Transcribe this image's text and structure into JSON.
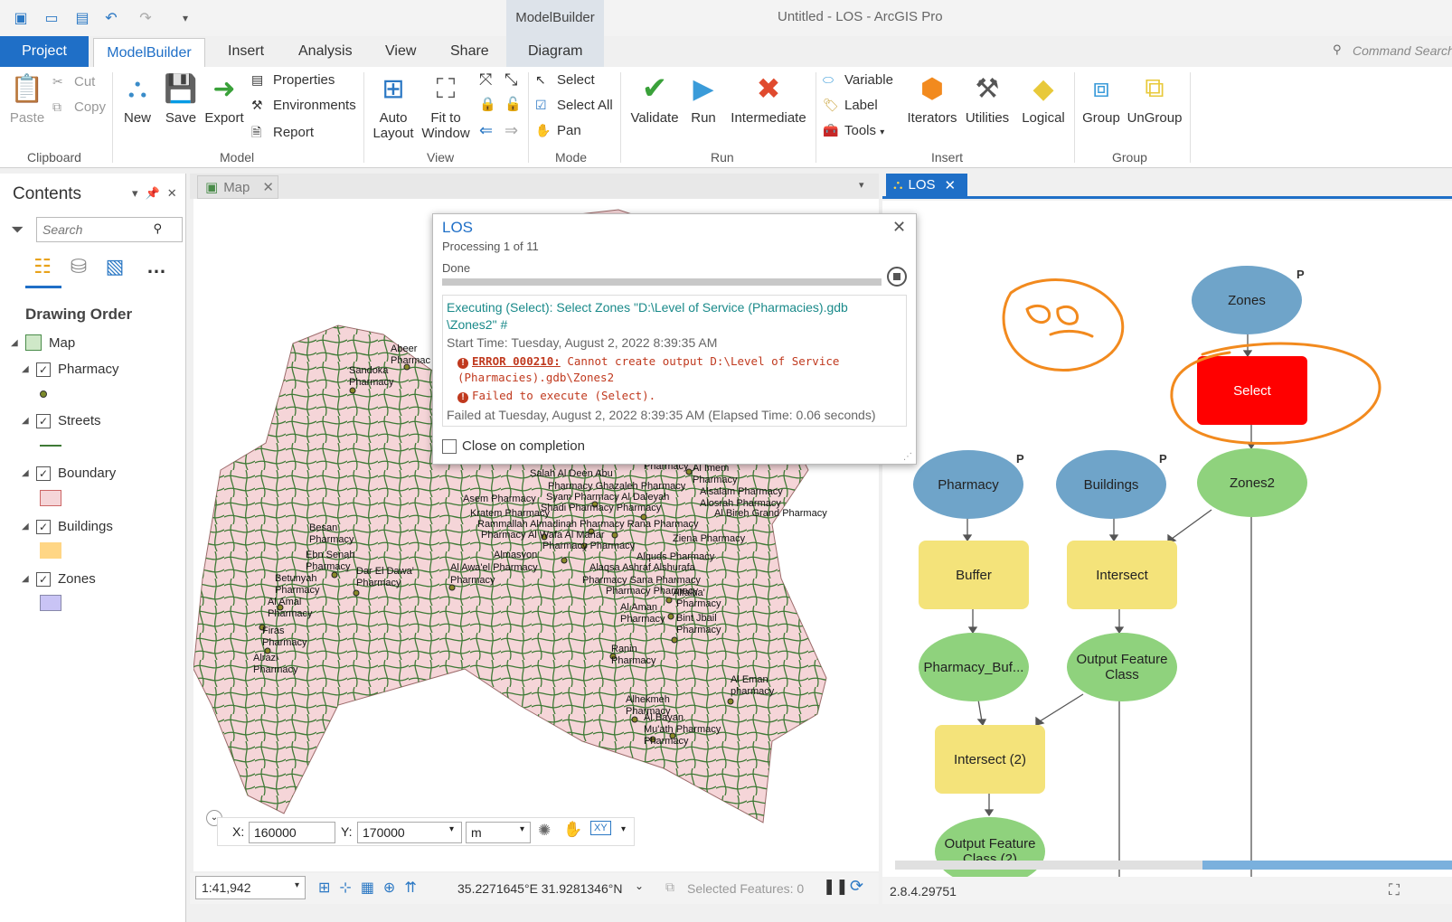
{
  "titlebar": {
    "contextual_group": "ModelBuilder",
    "window_title": "Untitled - LOS - ArcGIS Pro"
  },
  "ribbon_tabs": {
    "project": "Project",
    "modelbuilder": "ModelBuilder",
    "insert": "Insert",
    "analysis": "Analysis",
    "view": "View",
    "share": "Share",
    "diagram": "Diagram",
    "command_search": "Command Search"
  },
  "ribbon": {
    "clipboard": {
      "paste": "Paste",
      "cut": "Cut",
      "copy": "Copy",
      "label": "Clipboard"
    },
    "model": {
      "new": "New",
      "save": "Save",
      "export": "Export",
      "properties": "Properties",
      "environments": "Environments",
      "report": "Report",
      "label": "Model"
    },
    "view": {
      "auto_layout_1": "Auto",
      "auto_layout_2": "Layout",
      "fit_1": "Fit to",
      "fit_2": "Window",
      "label": "View"
    },
    "mode": {
      "select": "Select",
      "select_all": "Select All",
      "pan": "Pan",
      "label": "Mode"
    },
    "run": {
      "validate": "Validate",
      "run": "Run",
      "intermediate": "Intermediate",
      "label": "Run"
    },
    "insert": {
      "variable": "Variable",
      "label_btn": "Label",
      "tools": "Tools",
      "iterators": "Iterators",
      "utilities": "Utilities",
      "logical": "Logical",
      "label": "Insert"
    },
    "group": {
      "group": "Group",
      "ungroup": "UnGroup",
      "label": "Group"
    }
  },
  "contents": {
    "title": "Contents",
    "search_placeholder": "Search",
    "drawing_order": "Drawing Order",
    "map": "Map",
    "layers": [
      "Pharmacy",
      "Streets",
      "Boundary",
      "Buildings",
      "Zones"
    ]
  },
  "map": {
    "tab": "Map",
    "labels": [
      "Abeer\nPharmac",
      "Sandoka\nPharmacy",
      "Salah Al Deen Abu",
      "Pharmacy Ghazaleh Pharmacy",
      "Syam Pharmacy Al Daleyah",
      "Asem Pharmacy",
      "Shadi Pharmacy  Pharmacy",
      "Kratem Pharmacy",
      "Rammallah  Almadinah Pharmacy Rana Pharmacy",
      "Pharmacy      Al Wafa    Al Manar",
      "Pharmacy    Pharmacy",
      "Almasyon",
      "Al Awa'el Pharmacy",
      "Pharmacy",
      "Besan\nPharmacy",
      "Ebn Senah\nPharmacy",
      "Dar El Dawa'\nPharmacy",
      "Betunyah\nPharmacy",
      "Al Amal\nPharmacy",
      "Firas\nPharmacy",
      "Alrazi\nPharmacy",
      "Alsalam Pharmacy\nAlosrah Pharmacy",
      "Al Bireh Grand Pharmacy",
      "Ziena Pharmacy",
      "Alquds Pharmacy",
      "Alaqsa   Ashraf   Alshurafa",
      "Pharmacy   Sana  Pharmacy",
      "Pharmacy  Pharmacy",
      "Alfalna'",
      "Pharmacy",
      "Al Aman\nPharmacy",
      "Bint Jbail\nPharmacy",
      "Ranin\nPharmacy",
      "Al Eman\npharmacy",
      "Alhekmeh\nPharmacy",
      "Al Bayan\nMu'ath Pharmacy\nPharmacy",
      "Al Imem\nPharmacy",
      "Pharmacy"
    ],
    "coords": {
      "x_label": "X:",
      "x_value": "160000",
      "y_label": "Y:",
      "y_value": "170000",
      "unit": "m"
    },
    "scale": "1:41,942",
    "position": "35.2271645°E 31.9281346°N",
    "selected_features": "Selected Features: 0"
  },
  "model": {
    "tab": "LOS",
    "nodes": {
      "zones": "Zones",
      "select": "Select",
      "zones2": "Zones2",
      "pharmacy": "Pharmacy",
      "buildings": "Buildings",
      "buffer": "Buffer",
      "intersect": "Intersect",
      "pharmacy_buf": "Pharmacy_Buf...",
      "output_fc": "Output Feature Class",
      "intersect2": "Intersect (2)",
      "output_fc2": "Output Feature Class (2)"
    },
    "p_tag": "P",
    "version": "2.8.4.29751"
  },
  "dialog": {
    "title": "LOS",
    "processing": "Processing 1 of 11",
    "status": "Done",
    "exec_msg": "Executing (Select): Select Zones \"D:\\Level of Service (Pharmacies).gdb \\Zones2\" #",
    "start_time": "Start Time: Tuesday, August 2, 2022 8:39:35 AM",
    "error_code": "ERROR 000210:",
    "error_text_1": " Cannot create output D:\\Level of Service",
    "error_text_2": "(Pharmacies).gdb\\Zones2",
    "failed_exec": "Failed to execute (Select).",
    "failed_at": "Failed at Tuesday, August 2, 2022 8:39:35 AM (Elapsed Time: 0.06 seconds)",
    "close_on_completion": "Close on completion"
  },
  "colors": {
    "accent": "#1f6fc7",
    "boundary_fill": "#f5d5d8",
    "street": "#3f7a36",
    "buildings_swatch": "#ffd685",
    "zones_swatch": "#c9c4f5",
    "annotation": "#f28a1e",
    "error": "#c0391e"
  }
}
